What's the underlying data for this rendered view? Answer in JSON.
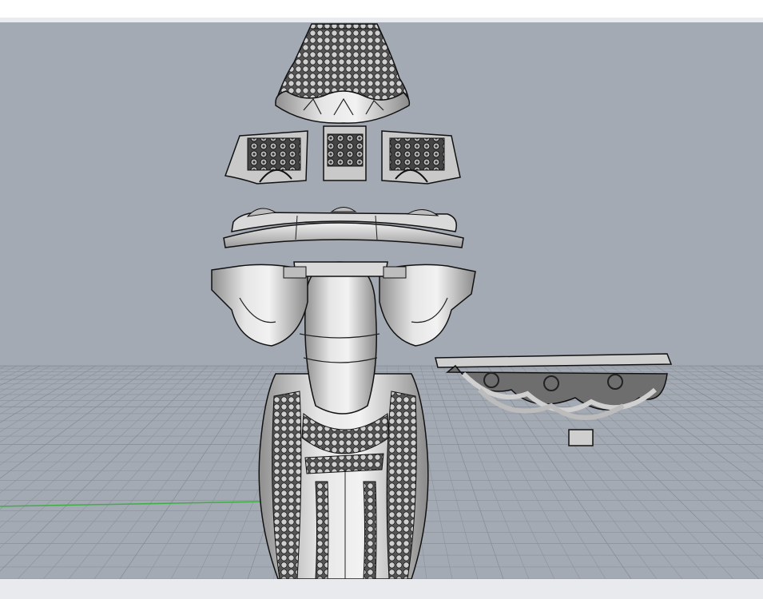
{
  "colors": {
    "viewport_background": "#a4aab3",
    "grid_line": "#8f959d",
    "grid_major": "#858b93",
    "x_axis": "#3fae49",
    "model_fill": "#d7d7d7",
    "model_shade": "#9e9e9e",
    "model_edge": "#111111",
    "top_bar": "#ffffff",
    "bottom_bar": "#e8eaee"
  },
  "viewport": {
    "view_mode": "shaded",
    "grid": true,
    "axis_visible": "x-axis"
  },
  "model": {
    "parts": [
      "crown-top",
      "prong-segments",
      "collar-ring",
      "petal-shells",
      "main-body",
      "filigree-base"
    ]
  }
}
